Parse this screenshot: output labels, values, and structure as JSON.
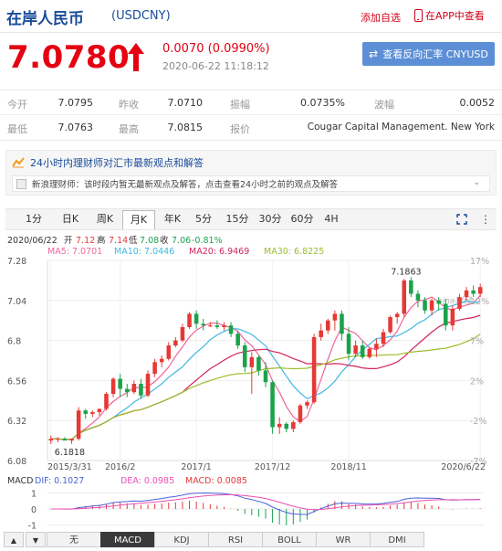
{
  "header": {
    "title": "在岸人民币",
    "code": "(USDCNY)",
    "add_watch": "添加自选",
    "app_view": "在APP中查看"
  },
  "quote": {
    "price": "7.0780",
    "change": "0.0070 (0.0990%)",
    "time": "2020-06-22 11:18:12",
    "reverse_button": "查看反向汇率 CNYUSD",
    "up_color": "#e50012"
  },
  "stats": {
    "row1": [
      {
        "label": "今开",
        "value": "7.0795"
      },
      {
        "label": "昨收",
        "value": "7.0710"
      },
      {
        "label": "振幅",
        "value": "0.0735%"
      },
      {
        "label": "波幅",
        "value": "0.0052"
      }
    ],
    "row2": [
      {
        "label": "最低",
        "value": "7.0763"
      },
      {
        "label": "最高",
        "value": "7.0815"
      },
      {
        "label": "报价",
        "value": "Cougar Capital Management. New York"
      }
    ]
  },
  "news": {
    "headline": "24小时内理财师对汇市最新观点和解答",
    "body": "新浪理财师：该时段内暂无最新观点及解答，点击查看24小时之前的观点及解答"
  },
  "period_tabs": [
    "1分",
    "日K",
    "周K",
    "月K",
    "年K",
    "5分",
    "15分",
    "30分",
    "60分",
    "4H"
  ],
  "active_period": "月K",
  "chart_data": {
    "type": "candlestick",
    "info_line": {
      "date": "2020/06/22",
      "open_label": "开",
      "open": "7.12",
      "high_label": "高",
      "high": "7.14",
      "low_label": "低",
      "low": "7.08",
      "close_label": "收",
      "close": "7.06",
      "pct": "-0.81%"
    },
    "ma_legend": [
      {
        "label": "MA5: 7.0701",
        "color": "#f0649a"
      },
      {
        "label": "MA10: 7.0446",
        "color": "#3fb7e0"
      },
      {
        "label": "MA20: 6.9469",
        "color": "#d0255e"
      },
      {
        "label": "MA30: 6.8225",
        "color": "#9bbe2c"
      }
    ],
    "y_ticks": [
      "7.28",
      "7.04",
      "6.8",
      "6.56",
      "6.32",
      "6.08"
    ],
    "y_ticks_values": [
      7.28,
      7.04,
      6.8,
      6.56,
      6.32,
      6.08
    ],
    "y_pct_ticks": [
      "17%",
      "12%",
      "7%",
      "2%",
      "-2%",
      "-7%"
    ],
    "x_ticks": [
      "2015/3/31",
      "2016/2",
      "2017/1",
      "2017/12",
      "2018/11",
      "2020/6/22"
    ],
    "x_tick_index": [
      0,
      10,
      21,
      32,
      43,
      62
    ],
    "ylim": [
      6.08,
      7.28
    ],
    "max_label": "7.1863",
    "min_label": "6.1818",
    "watermark": "sina财经",
    "colors": {
      "up": "#e53935",
      "down": "#1aa34a",
      "grid": "#eeeeee"
    },
    "ohlc": [
      [
        6.2,
        6.23,
        6.18,
        6.21
      ],
      [
        6.21,
        6.22,
        6.19,
        6.21
      ],
      [
        6.21,
        6.22,
        6.2,
        6.2
      ],
      [
        6.2,
        6.21,
        6.18,
        6.21
      ],
      [
        6.21,
        6.4,
        6.2,
        6.38
      ],
      [
        6.38,
        6.39,
        6.33,
        6.36
      ],
      [
        6.36,
        6.38,
        6.34,
        6.37
      ],
      [
        6.37,
        6.39,
        6.35,
        6.39
      ],
      [
        6.39,
        6.49,
        6.38,
        6.48
      ],
      [
        6.48,
        6.58,
        6.46,
        6.57
      ],
      [
        6.57,
        6.6,
        6.46,
        6.51
      ],
      [
        6.51,
        6.54,
        6.46,
        6.49
      ],
      [
        6.49,
        6.56,
        6.48,
        6.54
      ],
      [
        6.54,
        6.57,
        6.45,
        6.47
      ],
      [
        6.47,
        6.62,
        6.46,
        6.6
      ],
      [
        6.6,
        6.69,
        6.58,
        6.67
      ],
      [
        6.67,
        6.71,
        6.64,
        6.69
      ],
      [
        6.69,
        6.79,
        6.68,
        6.77
      ],
      [
        6.77,
        6.82,
        6.76,
        6.8
      ],
      [
        6.8,
        6.9,
        6.79,
        6.88
      ],
      [
        6.88,
        6.97,
        6.87,
        6.96
      ],
      [
        6.96,
        6.98,
        6.87,
        6.9
      ],
      [
        6.9,
        6.93,
        6.86,
        6.89
      ],
      [
        6.89,
        6.91,
        6.88,
        6.89
      ],
      [
        6.89,
        6.92,
        6.87,
        6.88
      ],
      [
        6.88,
        6.91,
        6.86,
        6.89
      ],
      [
        6.89,
        6.91,
        6.82,
        6.84
      ],
      [
        6.84,
        6.86,
        6.75,
        6.77
      ],
      [
        6.77,
        6.79,
        6.61,
        6.64
      ],
      [
        6.64,
        6.73,
        6.48,
        6.7
      ],
      [
        6.7,
        6.71,
        6.59,
        6.62
      ],
      [
        6.62,
        6.67,
        6.52,
        6.55
      ],
      [
        6.55,
        6.56,
        6.24,
        6.28
      ],
      [
        6.28,
        6.34,
        6.24,
        6.3
      ],
      [
        6.3,
        6.31,
        6.25,
        6.27
      ],
      [
        6.27,
        6.32,
        6.25,
        6.31
      ],
      [
        6.31,
        6.42,
        6.3,
        6.41
      ],
      [
        6.41,
        6.44,
        6.39,
        6.43
      ],
      [
        6.43,
        6.84,
        6.42,
        6.82
      ],
      [
        6.82,
        6.9,
        6.8,
        6.86
      ],
      [
        6.86,
        6.93,
        6.84,
        6.92
      ],
      [
        6.92,
        6.98,
        6.86,
        6.96
      ],
      [
        6.96,
        6.98,
        6.8,
        6.84
      ],
      [
        6.84,
        6.88,
        6.68,
        6.72
      ],
      [
        6.72,
        6.8,
        6.7,
        6.77
      ],
      [
        6.77,
        6.8,
        6.69,
        6.7
      ],
      [
        6.7,
        6.76,
        6.69,
        6.75
      ],
      [
        6.75,
        6.81,
        6.7,
        6.78
      ],
      [
        6.78,
        6.87,
        6.76,
        6.85
      ],
      [
        6.85,
        6.95,
        6.84,
        6.94
      ],
      [
        6.94,
        6.97,
        6.9,
        6.96
      ],
      [
        6.96,
        7.17,
        6.94,
        7.16
      ],
      [
        7.16,
        7.18,
        7.06,
        7.08
      ],
      [
        7.08,
        7.1,
        7.0,
        7.04
      ],
      [
        7.04,
        7.06,
        6.96,
        6.98
      ],
      [
        6.98,
        7.05,
        6.95,
        7.04
      ],
      [
        7.04,
        7.06,
        6.98,
        7.02
      ],
      [
        7.02,
        7.05,
        6.86,
        6.89
      ],
      [
        6.89,
        7.01,
        6.86,
        6.99
      ],
      [
        6.99,
        7.08,
        6.98,
        7.06
      ],
      [
        7.06,
        7.12,
        7.04,
        7.1
      ],
      [
        7.1,
        7.13,
        7.06,
        7.08
      ],
      [
        7.08,
        7.14,
        7.06,
        7.12
      ]
    ],
    "macd_legend": {
      "name": "MACD",
      "dif": "DIF: 0.1027",
      "dea": "DEA: 0.0985",
      "macd": "MACD: 0.0085"
    },
    "macd_y_ticks": [
      "1",
      "0",
      "-1"
    ],
    "macd_y_values": [
      1,
      0,
      -1
    ],
    "macd_ylim": [
      -1.3,
      1.3
    ],
    "macd_colors": {
      "dif": "#4a63d8",
      "dea": "#ef4fb2",
      "hist_up": "#e53935",
      "hist_down": "#1aa34a"
    }
  },
  "indicator_tabs": [
    "无",
    "MACD",
    "KDJ",
    "RSI",
    "BOLL",
    "WR",
    "DMI"
  ],
  "active_indicator": "MACD"
}
